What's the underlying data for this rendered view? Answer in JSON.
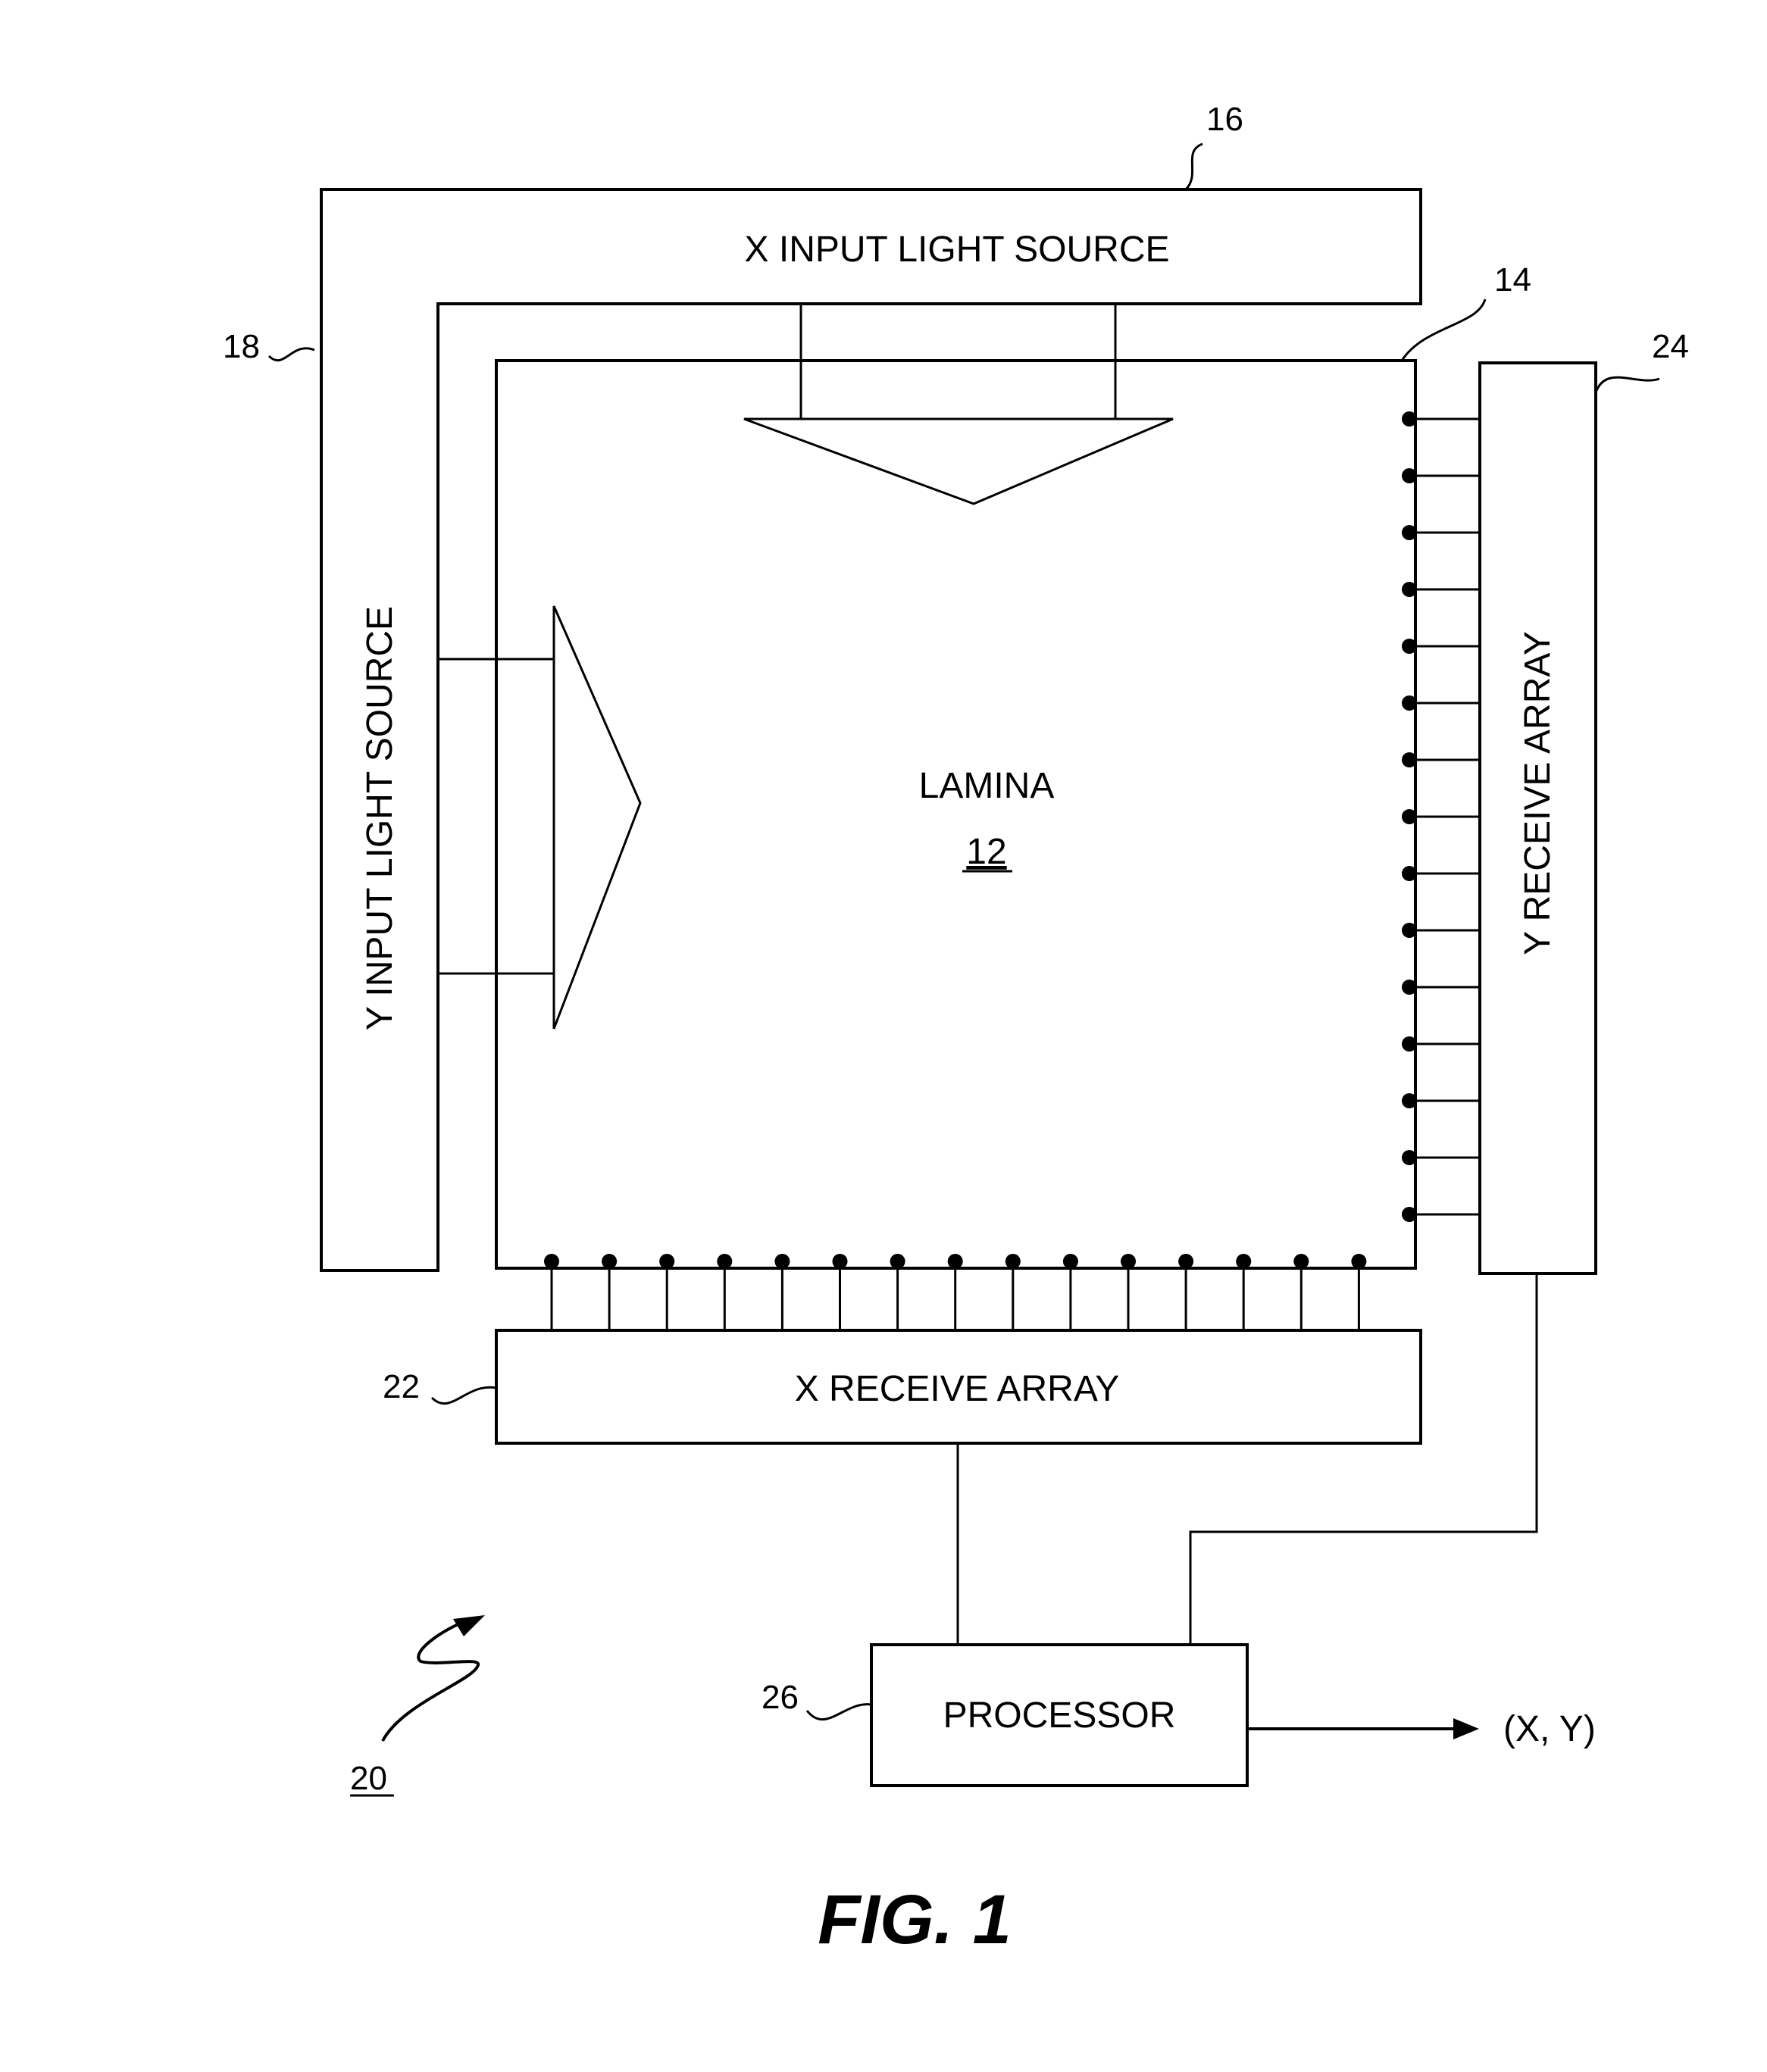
{
  "figure": {
    "caption": "FIG. 1",
    "system_ref": "20",
    "output_label": "(X, Y)",
    "sensor_count_per_side": 15
  },
  "components": {
    "x_source": {
      "label": "X INPUT LIGHT SOURCE",
      "ref": "16"
    },
    "y_source": {
      "label": "Y INPUT LIGHT SOURCE",
      "ref": "18"
    },
    "lamina": {
      "label": "LAMINA",
      "ref": "12",
      "edge_ref": "14"
    },
    "x_receive": {
      "label": "X RECEIVE ARRAY",
      "ref": "22"
    },
    "y_receive": {
      "label": "Y RECEIVE ARRAY",
      "ref": "24"
    },
    "processor": {
      "label": "PROCESSOR",
      "ref": "26"
    }
  }
}
